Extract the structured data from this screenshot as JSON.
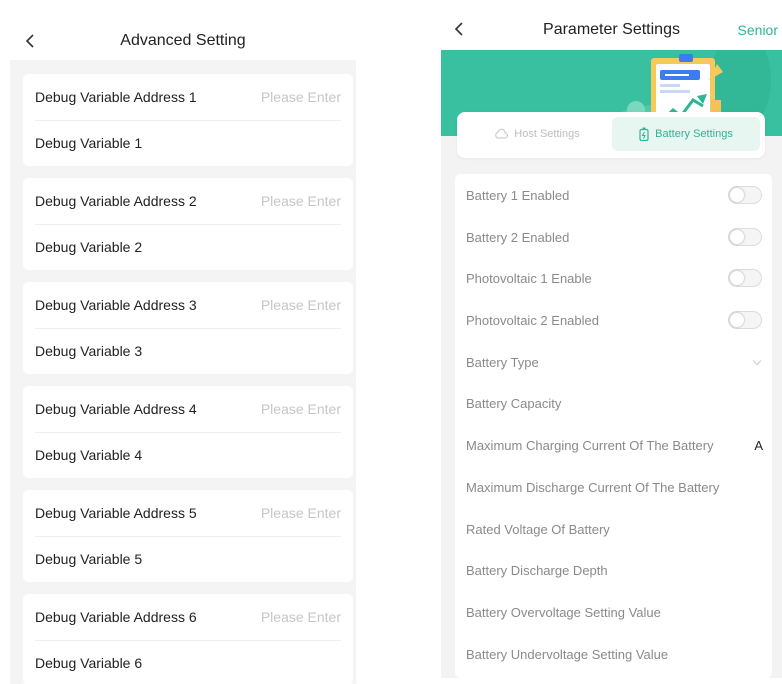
{
  "advanced": {
    "title": "Advanced Setting",
    "cards": [
      {
        "address_label": "Debug Variable Address 1",
        "placeholder": "Please Enter",
        "variable_label": "Debug Variable 1"
      },
      {
        "address_label": "Debug Variable Address 2",
        "placeholder": "Please Enter",
        "variable_label": "Debug Variable 2"
      },
      {
        "address_label": "Debug Variable Address 3",
        "placeholder": "Please Enter",
        "variable_label": "Debug Variable 3"
      },
      {
        "address_label": "Debug Variable Address 4",
        "placeholder": "Please Enter",
        "variable_label": "Debug Variable 4"
      },
      {
        "address_label": "Debug Variable Address 5",
        "placeholder": "Please Enter",
        "variable_label": "Debug Variable 5"
      },
      {
        "address_label": "Debug Variable Address 6",
        "placeholder": "Please Enter",
        "variable_label": "Debug Variable 6"
      }
    ]
  },
  "parameter": {
    "title": "Parameter Settings",
    "senior_label": "Senior",
    "accent_color": "#38c0a0",
    "tabs": [
      {
        "label": "Host Settings",
        "icon": "cloud-icon",
        "active": false
      },
      {
        "label": "Battery Settings",
        "icon": "battery-icon",
        "active": true
      }
    ],
    "rows": [
      {
        "label": "Battery 1 Enabled",
        "control": "toggle",
        "checked": false
      },
      {
        "label": "Battery 2 Enabled",
        "control": "toggle",
        "checked": false
      },
      {
        "label": "Photovoltaic 1 Enable",
        "control": "toggle",
        "checked": false
      },
      {
        "label": "Photovoltaic 2 Enabled",
        "control": "toggle",
        "checked": false
      },
      {
        "label": "Battery Type",
        "control": "dropdown"
      },
      {
        "label": "Battery Capacity",
        "control": "none"
      },
      {
        "label": "Maximum Charging Current Of The Battery",
        "control": "unit",
        "unit": "A"
      },
      {
        "label": "Maximum Discharge Current Of The Battery",
        "control": "none"
      },
      {
        "label": "Rated Voltage Of Battery",
        "control": "none"
      },
      {
        "label": "Battery Discharge Depth",
        "control": "none"
      },
      {
        "label": "Battery Overvoltage Setting Value",
        "control": "none"
      },
      {
        "label": "Battery Undervoltage Setting Value",
        "control": "none"
      }
    ]
  }
}
